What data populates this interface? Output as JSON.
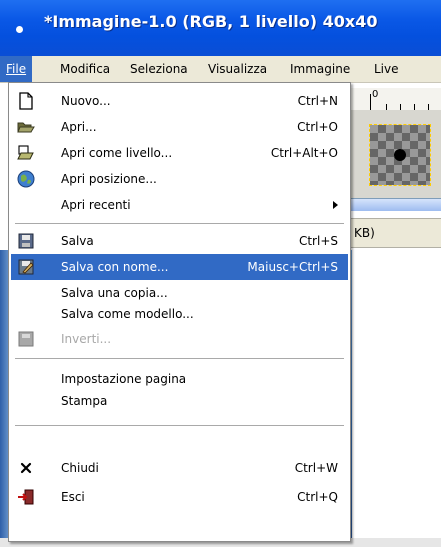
{
  "window": {
    "title": "*Immagine-1.0 (RGB, 1 livello) 40x40"
  },
  "menubar": [
    {
      "label": "File"
    },
    {
      "label": "Modifica"
    },
    {
      "label": "Seleziona"
    },
    {
      "label": "Visualizza"
    },
    {
      "label": "Immagine"
    },
    {
      "label": "Live"
    }
  ],
  "ruler": {
    "zero_label": "0"
  },
  "statusbar": {
    "text": "KB)"
  },
  "file_menu": {
    "items": [
      {
        "label": "Nuovo...",
        "shortcut": "Ctrl+N",
        "icon": "new-document-icon"
      },
      {
        "label": "Apri...",
        "shortcut": "Ctrl+O",
        "icon": "open-folder-icon"
      },
      {
        "label": "Apri come livello...",
        "shortcut": "Ctrl+Alt+O",
        "icon": "open-as-layer-icon"
      },
      {
        "label": "Apri posizione...",
        "shortcut": "",
        "icon": "globe-icon"
      },
      {
        "label": "Apri recenti",
        "shortcut": "",
        "submenu": true
      },
      {
        "label": "Salva",
        "shortcut": "Ctrl+S",
        "icon": "save-icon"
      },
      {
        "label": "Salva con nome...",
        "shortcut": "Maiusc+Ctrl+S",
        "icon": "save-as-icon",
        "highlighted": true
      },
      {
        "label": "Salva una copia...",
        "shortcut": ""
      },
      {
        "label": "Salva come modello...",
        "shortcut": ""
      },
      {
        "label": "Inverti...",
        "shortcut": "",
        "icon": "revert-icon",
        "disabled": true
      },
      {
        "label": "Impostazione pagina",
        "shortcut": ""
      },
      {
        "label": "Stampa",
        "shortcut": ""
      },
      {
        "label": "Chiudi",
        "shortcut": "Ctrl+W",
        "icon": "close-icon"
      },
      {
        "label": "Esci",
        "shortcut": "Ctrl+Q",
        "icon": "quit-icon"
      }
    ]
  },
  "colors": {
    "title_bar": "#0a58e6",
    "highlight": "#316ac5",
    "menubar": "#ece9d8"
  }
}
